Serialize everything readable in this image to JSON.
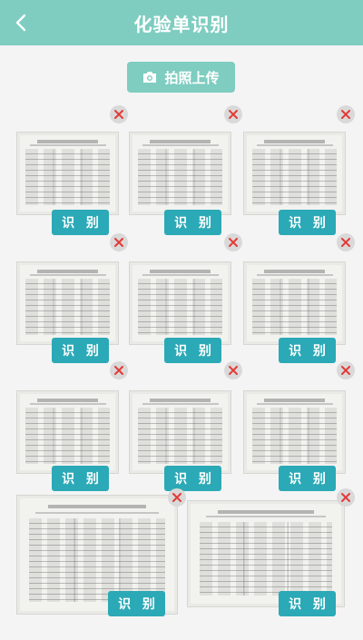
{
  "header": {
    "title": "化验单识别",
    "back_icon": "chevron-left-icon"
  },
  "upload": {
    "label": "拍照上传",
    "icon": "camera-icon"
  },
  "recognize_label": "识别",
  "delete_icon": "close-icon",
  "colors": {
    "accent": "#7ecdc0",
    "button": "#2ba9b6",
    "close": "#e53935"
  },
  "items": [
    {
      "recognize": "识 别"
    },
    {
      "recognize": "识 别"
    },
    {
      "recognize": "识 别"
    },
    {
      "recognize": "识 别"
    },
    {
      "recognize": "识 别"
    },
    {
      "recognize": "识 别"
    },
    {
      "recognize": "识 别"
    },
    {
      "recognize": "识 别"
    },
    {
      "recognize": "识 别"
    },
    {
      "recognize": "识 别"
    },
    {
      "recognize": "识 别"
    }
  ]
}
